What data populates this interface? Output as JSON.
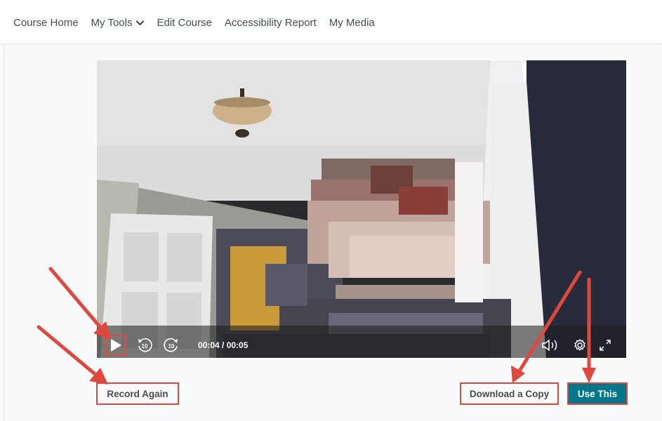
{
  "nav": {
    "items": [
      {
        "label": "Course Home"
      },
      {
        "label": "My Tools"
      },
      {
        "label": "Edit Course"
      },
      {
        "label": "Accessibility Report"
      },
      {
        "label": "My Media"
      }
    ]
  },
  "player": {
    "time": "00:04 / 00:05",
    "progress": 0.8,
    "controls": {
      "play": "play-icon",
      "rewind": "rewind-10-icon",
      "forward": "forward-10-icon",
      "volume": "volume-icon",
      "settings": "gear-icon",
      "fullscreen": "fullscreen-icon"
    }
  },
  "buttons": {
    "record_again": "Record Again",
    "download_copy": "Download a Copy",
    "use_this": "Use This"
  },
  "colors": {
    "accent": "#00768a",
    "progress": "#2aa3bb",
    "annotation": "#e0473d"
  }
}
